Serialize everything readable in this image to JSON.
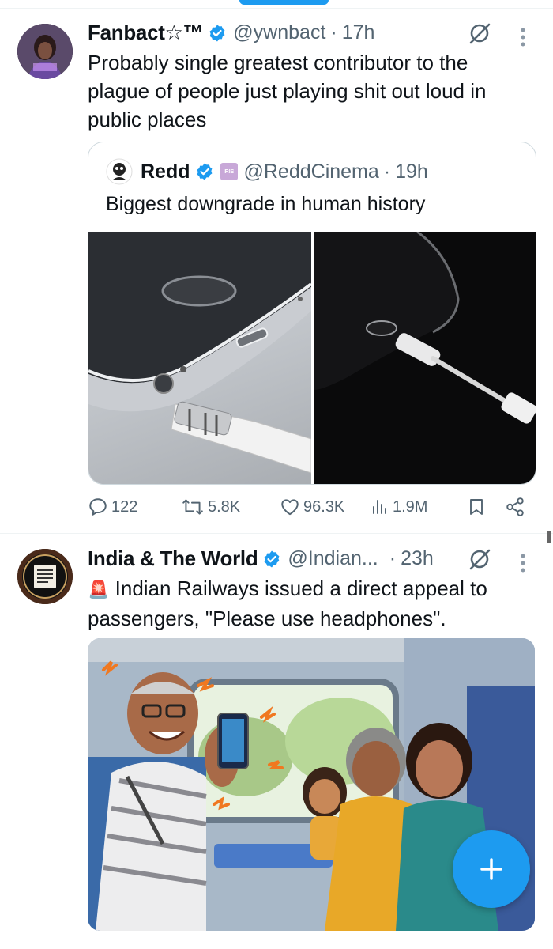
{
  "tweet1": {
    "name": "Fanbact☆™",
    "handle": "@ywnbact",
    "dot": "·",
    "time": "17h",
    "text": "Probably single greatest contributor to the plague of people just playing shit out loud in public places",
    "quote": {
      "name": "Redd",
      "handle": "@ReddCinema",
      "dot": "·",
      "time": "19h",
      "affiliate_badge": "IRIS",
      "text": "Biggest downgrade in human history"
    },
    "actions": {
      "replies": "122",
      "reposts": "5.8K",
      "likes": "96.3K",
      "views": "1.9M"
    }
  },
  "tweet2": {
    "name": "India & The World",
    "handle": "@Indian...",
    "dot": "·",
    "time": "23h",
    "emoji": "🚨",
    "text": "Indian Railways issued a direct appeal to passengers, \"Please use headphones\"."
  },
  "colors": {
    "accent": "#1d9bf0",
    "muted": "#536471",
    "border": "#cfd9de"
  },
  "icons": [
    "verified-icon",
    "grok-icon",
    "more-icon",
    "reply-icon",
    "repost-icon",
    "like-icon",
    "views-icon",
    "bookmark-icon",
    "share-icon",
    "plus-icon"
  ]
}
